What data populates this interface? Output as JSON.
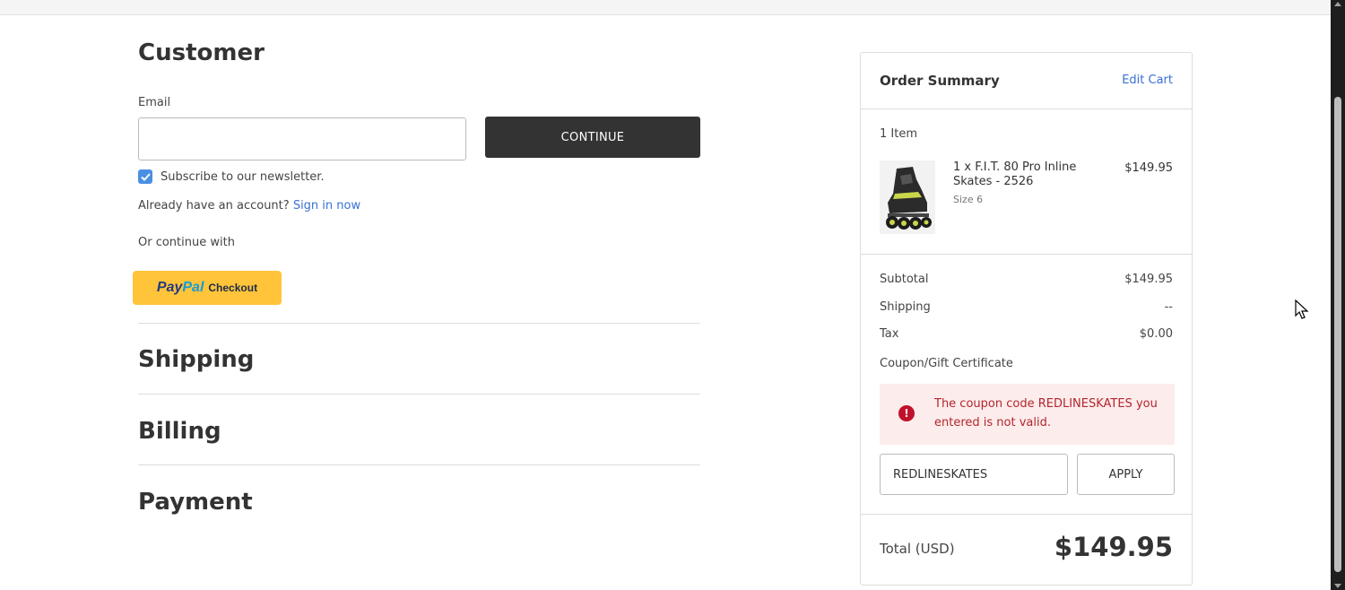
{
  "customer": {
    "heading": "Customer",
    "email_label": "Email",
    "email_value": "",
    "continue_label": "CONTINUE",
    "subscribe_label": "Subscribe to our newsletter.",
    "subscribe_checked": true,
    "account_prompt": "Already have an account?",
    "sign_in_label": "Sign in now",
    "or_continue": "Or continue with",
    "paypal_pay": "Pay",
    "paypal_pal": "Pal",
    "paypal_checkout": "Checkout"
  },
  "sections": {
    "shipping": "Shipping",
    "billing": "Billing",
    "payment": "Payment"
  },
  "summary": {
    "title": "Order Summary",
    "edit_cart": "Edit Cart",
    "item_count": "1 Item",
    "item": {
      "name": "1 x F.I.T. 80 Pro Inline Skates - 2526",
      "size": "Size 6",
      "price": "$149.95"
    },
    "subtotal_label": "Subtotal",
    "subtotal_value": "$149.95",
    "shipping_label": "Shipping",
    "shipping_value": "--",
    "tax_label": "Tax",
    "tax_value": "$0.00",
    "coupon_label": "Coupon/Gift Certificate",
    "coupon_error": "The coupon code REDLINESKATES you entered is not valid.",
    "coupon_value": "REDLINESKATES",
    "apply_label": "APPLY",
    "total_label": "Total (USD)",
    "total_value": "$149.95"
  },
  "colors": {
    "link": "#3a6fd8",
    "primary_button": "#333333",
    "paypal": "#ffc439",
    "error_bg": "#fdecec",
    "error_text": "#b3262e",
    "checkbox": "#4a90e2"
  },
  "icons": {
    "checkbox": "checkmark-icon",
    "error": "error-circle-icon",
    "cursor": "mouse-pointer-icon"
  }
}
